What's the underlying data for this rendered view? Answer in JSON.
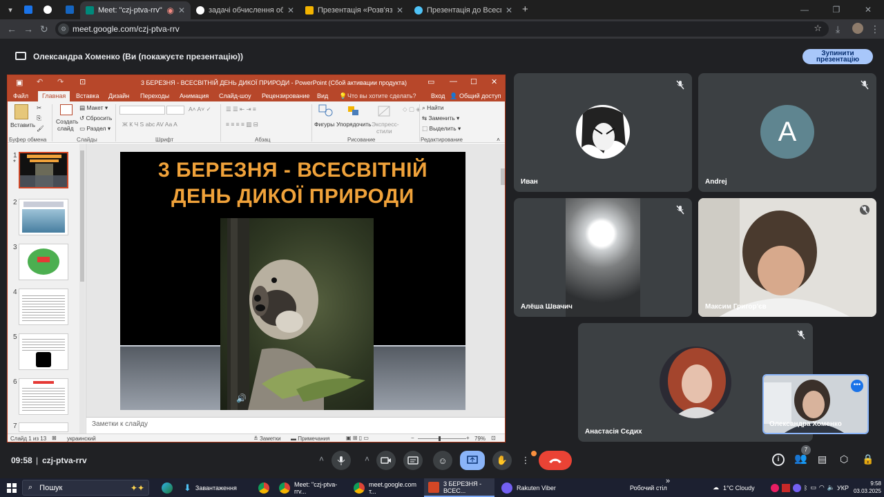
{
  "browser": {
    "tabs": [
      {
        "label": "Meet: \"czj-ptva-rrv\""
      },
      {
        "label": "задачі обчислення обемних в"
      },
      {
        "label": "Презентація «Розв'язування р"
      },
      {
        "label": "Презентація до Всесвітнього д"
      }
    ],
    "url": "meet.google.com/czj-ptva-rrv"
  },
  "presenting": {
    "text": "Олександра Хоменко (Ви (покажуєте презентацію))",
    "stop_line1": "Зупинити",
    "stop_line2": "презентацію"
  },
  "ppt": {
    "title": "3  БЕРЕЗНЯ - ВСЕСВІТНІЙ ДЕНЬ ДИКОЇ ПРИРОДИ - PowerPoint (Сбой активации продукта)",
    "menu": [
      "Файл",
      "Главная",
      "Вставка",
      "Дизайн",
      "Переходы",
      "Анимация",
      "Слайд-шоу",
      "Рецензирование",
      "Вид"
    ],
    "tell_me": "Что вы хотите сделать?",
    "login": "Вход",
    "share": "Общий доступ",
    "ribbon": {
      "paste": "Вставить",
      "new_slide_1": "Создать",
      "new_slide_2": "слайд",
      "layout": "Макет",
      "reset": "Сбросить",
      "section": "Раздел",
      "shapes": "Фигуры",
      "arrange": "Упорядочить",
      "quick_styles_1": "Экспресс-",
      "quick_styles_2": "стили",
      "find": "Найти",
      "replace": "Заменить",
      "select": "Выделить",
      "groups": [
        "Буфер обмена",
        "Слайды",
        "Шрифт",
        "Абзац",
        "Рисование",
        "Редактирование"
      ]
    },
    "thumb_numbers": [
      "1",
      "2",
      "3",
      "4",
      "5",
      "6",
      "7"
    ],
    "slide_title_1": "3  БЕРЕЗНЯ - ВСЕСВІТНІЙ",
    "slide_title_2": "ДЕНЬ ДИКОЇ ПРИРОДИ",
    "notes_placeholder": "Заметки к слайду",
    "status": {
      "slide": "Слайд 1 из 13",
      "lang": "украинский",
      "notes": "Заметки",
      "comments": "Примечания",
      "zoom": "79%"
    }
  },
  "participants": [
    {
      "name": "Иван"
    },
    {
      "name": "Andrej",
      "initial": "A"
    },
    {
      "name": "Алёша Швачич"
    },
    {
      "name": "Максим Григор'єв"
    },
    {
      "name": "Анастасія Сєдих"
    },
    {
      "name": "Олександра Хоменко"
    }
  ],
  "meet": {
    "time": "09:58",
    "code": "czj-ptva-rrv",
    "people_count": "7"
  },
  "taskbar": {
    "search": "Пошук",
    "downloads": "Завантаження",
    "meet_window": "Meet: \"czj-ptva-rrv...",
    "google_window": "meet.google.com т...",
    "ppt_window": "3  БЕРЕЗНЯ - ВСЕС...",
    "viber": "Rakuten Viber",
    "desktop": "Робочий стіл",
    "weather": "1°C  Cloudy",
    "lang": "УКР",
    "clock_time": "9:58",
    "clock_date": "03.03.2025"
  },
  "colors": {
    "ppt_red": "#b7472a",
    "slide_title": "#f0a23a",
    "meet_bg": "#202124",
    "tile_bg": "#3c4043",
    "end_call": "#ea4335",
    "active_blue": "#8ab4f8"
  }
}
